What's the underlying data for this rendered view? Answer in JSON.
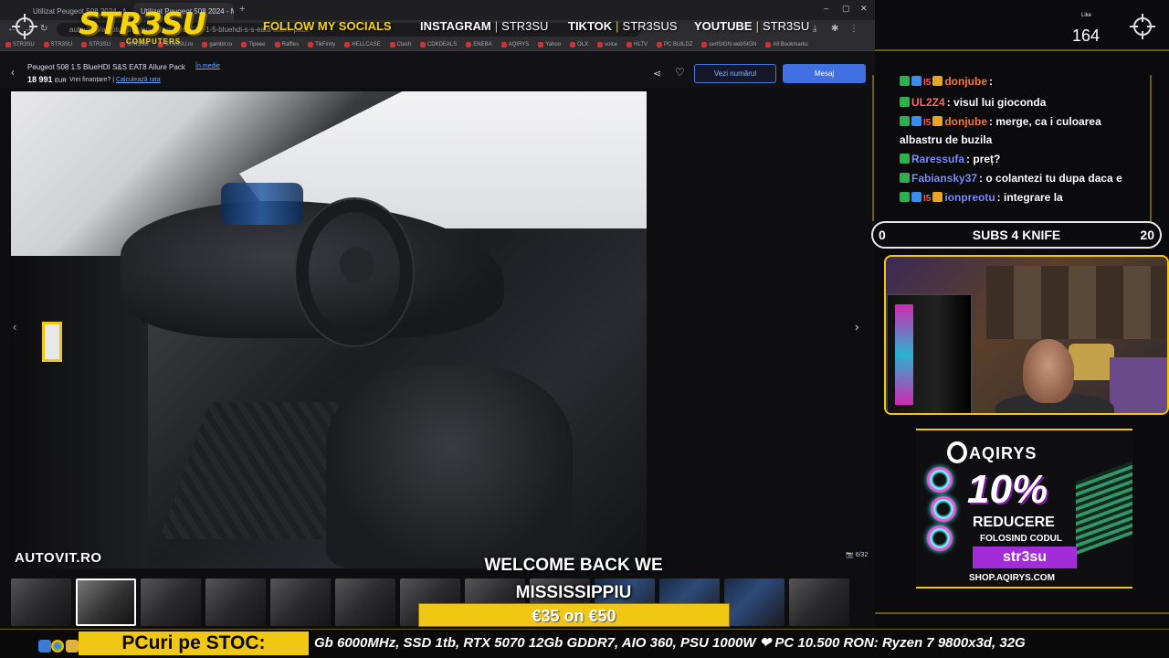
{
  "browser": {
    "tab1": "Utilizat Peugeot 508 2024 - Mi",
    "tab2": "Utilizat Peugeot 508 2024 - Mi",
    "url": "autovit.ro/autoturisme/anunt/peugeot-508-1-5-bluehdi-s-s-eat8-allure-pack",
    "bookmarks": [
      "STR3SU",
      "STR3SU",
      "STR3SU",
      "STR3SU",
      "STR3SU.ro",
      "gamblr.ro",
      "Tipeee",
      "Raffles",
      "TikFinity",
      "HELLCASE",
      "Clash",
      "CDKDEALS",
      "ENEBA",
      "AQIRYS",
      "Yahoo",
      "OLX",
      "voice",
      "HLTV",
      "PC BUILDZ",
      "certSIGN webSIGN",
      "All Bookmarks"
    ]
  },
  "overlay": {
    "logo": "STR3SU",
    "logo_sub": "COMPUTERS",
    "follow": "FOLLOW MY SOCIALS",
    "socials": [
      {
        "network": "INSTAGRAM",
        "handle": "STR3SU"
      },
      {
        "network": "TIKTOK",
        "handle": "STR3SUS"
      },
      {
        "network": "YOUTUBE",
        "handle": "STR3SU"
      }
    ]
  },
  "listing": {
    "title": "Peugeot 508 1.5 BlueHDI S&S EAT8 Allure Pack",
    "condition_link": "În medie",
    "price": "18 991",
    "currency": "EUR",
    "finance_q": "Vrei finanțare? |",
    "finance_link": "Calculează rata",
    "btn_number": "Vezi numărul",
    "btn_message": "Mesaj",
    "watermark": "AUTOVIT.RO",
    "photo_counter": "6/32"
  },
  "like": {
    "label": "Like",
    "count": "164"
  },
  "subs": {
    "left": "0",
    "title": "SUBS 4 KNIFE",
    "right": "20"
  },
  "chat": [
    {
      "user": "donjube",
      "user_color": "#ff7a2f",
      "msg": ":",
      "badges": [
        "green",
        "blue",
        "red",
        "gold"
      ]
    },
    {
      "user": "UL2Z4",
      "user_color": "#ff6a6a",
      "msg": ": visul lui gioconda",
      "badges": [
        "green"
      ]
    },
    {
      "user": "donjube",
      "user_color": "#ff7a2f",
      "msg": ": merge, ca i culoarea albastru de buzila",
      "badges": [
        "green",
        "blue",
        "red",
        "gold"
      ]
    },
    {
      "user": "Raressufa",
      "user_color": "#7a8cff",
      "msg": ": preț?",
      "badges": [
        "green"
      ]
    },
    {
      "user": "Fabiansky37",
      "user_color": "#7a8cff",
      "msg": ": o colantezi tu dupa daca e",
      "badges": [
        "green"
      ]
    },
    {
      "user": "ionpreotu",
      "user_color": "#7a8cff",
      "msg": ": integrare la",
      "badges": [
        "green",
        "blue",
        "red",
        "gold"
      ]
    }
  ],
  "sponsor": {
    "brand": "AQIRYS",
    "pct": "10%",
    "reducere": "REDUCERE",
    "folosind": "FOLOSIND CODUL",
    "code": "str3su",
    "shop": "SHOP.AQIRYS.COM"
  },
  "caption": {
    "line1": "WELCOME BACK WE",
    "line2": "MISSISSIPPIU"
  },
  "promo": "€35 on €50",
  "ticker": {
    "label": "PCuri pe STOC:",
    "text": "Gb 6000MHz, SSD 1tb, RTX 5070 12Gb GDDR7, AIO 360, PSU 1000W  ❤ PC 10.500 RON: Ryzen 7 9800x3d, 32G"
  },
  "colors": {
    "accent": "#f0c814",
    "link": "#6aa8ff",
    "button": "#3f6fe0"
  }
}
